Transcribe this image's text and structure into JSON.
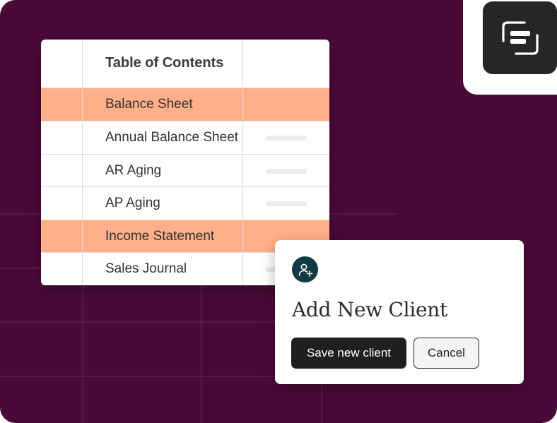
{
  "colors": {
    "background": "#4a0a38",
    "highlight": "#ffb088",
    "logo_tile": "#262626",
    "modal_icon": "#0f3b44",
    "primary_button": "#1f1f1f"
  },
  "toc": {
    "title": "Table of Contents",
    "rows": [
      {
        "label": "Balance Sheet",
        "highlighted": true
      },
      {
        "label": "Annual Balance Sheet",
        "highlighted": false
      },
      {
        "label": "AR Aging",
        "highlighted": false
      },
      {
        "label": "AP Aging",
        "highlighted": false
      },
      {
        "label": "Income Statement",
        "highlighted": true
      },
      {
        "label": "Sales Journal",
        "highlighted": false
      }
    ]
  },
  "modal": {
    "icon": "add-user-icon",
    "title": "Add New Client",
    "save_label": "Save new client",
    "cancel_label": "Cancel"
  },
  "logo": {
    "icon": "app-logo-icon"
  }
}
